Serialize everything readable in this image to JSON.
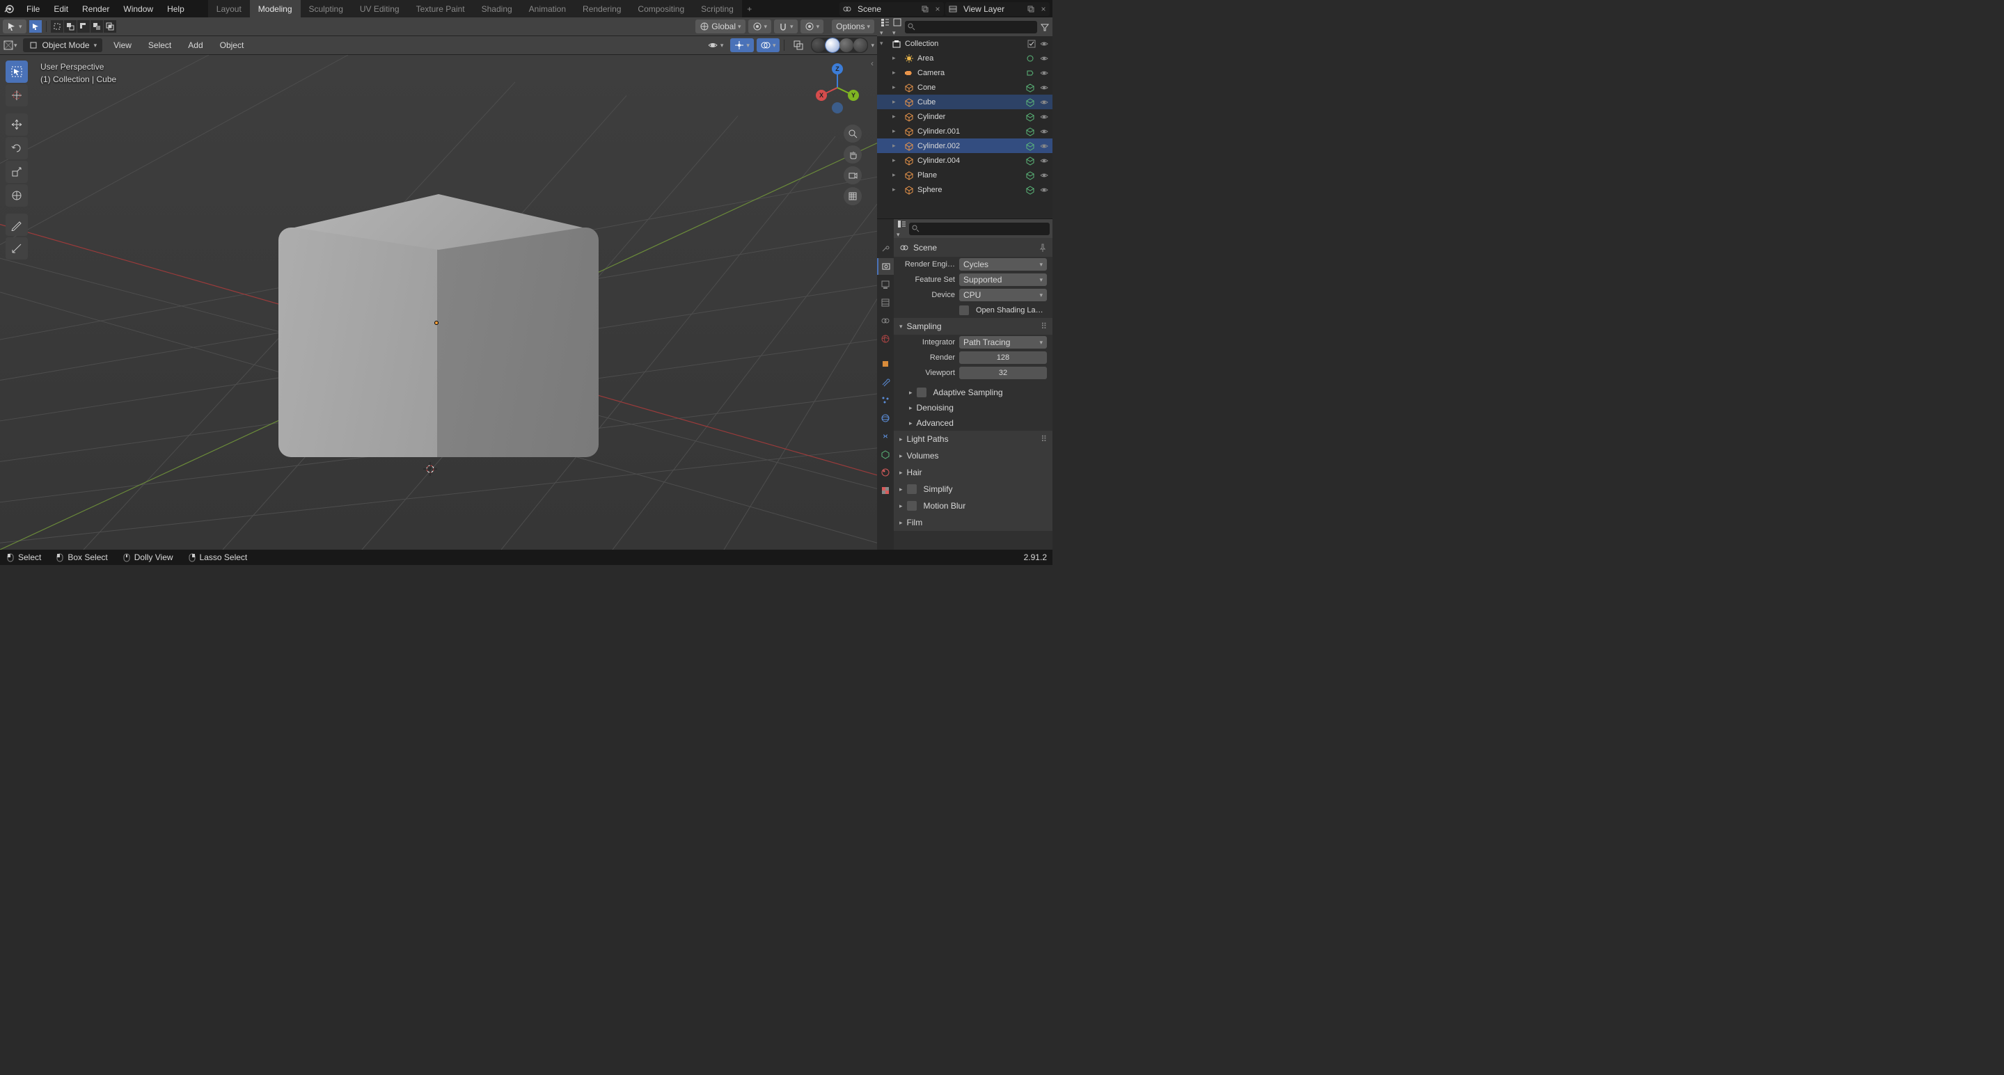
{
  "top_menu": [
    "File",
    "Edit",
    "Render",
    "Window",
    "Help"
  ],
  "workspaces": [
    "Layout",
    "Modeling",
    "Sculpting",
    "UV Editing",
    "Texture Paint",
    "Shading",
    "Animation",
    "Rendering",
    "Compositing",
    "Scripting"
  ],
  "workspace_active": "Modeling",
  "scene_name": "Scene",
  "layer_name": "View Layer",
  "viewport": {
    "orientation": "Global",
    "options_label": "Options",
    "mode": "Object Mode",
    "menus": [
      "View",
      "Select",
      "Add",
      "Object"
    ],
    "overlay_line1": "User Perspective",
    "overlay_line2": "(1) Collection | Cube"
  },
  "outliner": {
    "collection": "Collection",
    "items": [
      {
        "name": "Area",
        "type": "light"
      },
      {
        "name": "Camera",
        "type": "camera"
      },
      {
        "name": "Cone",
        "type": "mesh"
      },
      {
        "name": "Cube",
        "type": "mesh",
        "active": true
      },
      {
        "name": "Cylinder",
        "type": "mesh"
      },
      {
        "name": "Cylinder.001",
        "type": "mesh"
      },
      {
        "name": "Cylinder.002",
        "type": "mesh",
        "selected": true
      },
      {
        "name": "Cylinder.004",
        "type": "mesh"
      },
      {
        "name": "Plane",
        "type": "mesh"
      },
      {
        "name": "Sphere",
        "type": "mesh"
      }
    ]
  },
  "props": {
    "context": "Scene",
    "render_engine_label": "Render Engi…",
    "render_engine": "Cycles",
    "feature_set_label": "Feature Set",
    "feature_set": "Supported",
    "device_label": "Device",
    "device": "CPU",
    "osl_label": "Open Shading La…",
    "sampling_header": "Sampling",
    "integrator_label": "Integrator",
    "integrator": "Path Tracing",
    "render_label": "Render",
    "render_samples": "128",
    "viewport_label": "Viewport",
    "viewport_samples": "32",
    "adaptive_label": "Adaptive Sampling",
    "denoising_label": "Denoising",
    "advanced_label": "Advanced",
    "light_paths_label": "Light Paths",
    "volumes_label": "Volumes",
    "hair_label": "Hair",
    "simplify_label": "Simplify",
    "motion_blur_label": "Motion Blur",
    "film_label": "Film"
  },
  "status": {
    "select": "Select",
    "box": "Box Select",
    "dolly": "Dolly View",
    "lasso": "Lasso Select",
    "version": "2.91.2"
  }
}
